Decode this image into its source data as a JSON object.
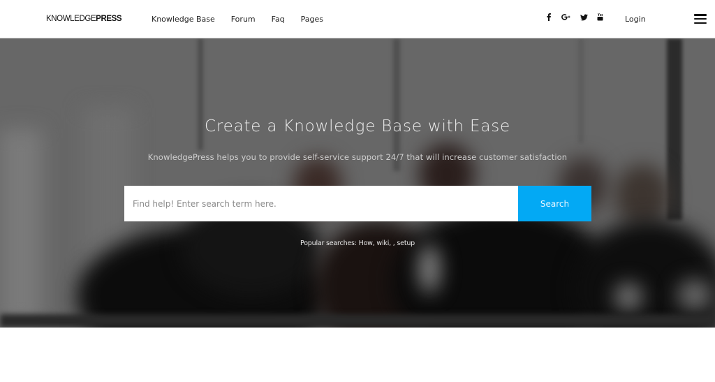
{
  "header": {
    "logo_light": "KNOWLEDGE",
    "logo_bold": "PRESS",
    "nav": [
      {
        "label": "Knowledge Base"
      },
      {
        "label": "Forum"
      },
      {
        "label": "Faq"
      },
      {
        "label": "Pages"
      }
    ],
    "social": [
      {
        "name": "facebook-icon",
        "glyph": "f"
      },
      {
        "name": "google-plus-icon",
        "glyph": "G+"
      },
      {
        "name": "twitter-icon",
        "glyph": "twitter"
      },
      {
        "name": "youtube-icon",
        "glyph": "youtube"
      }
    ],
    "login_label": "Login",
    "menu_icon": "hamburger-icon"
  },
  "hero": {
    "title": "Create a Knowledge Base with Ease",
    "subtitle": "KnowledgePress helps you to provide self-service support 24/7 that will increase customer satisfaction",
    "search": {
      "placeholder": "Find help! Enter search term here.",
      "value": "",
      "button_label": "Search"
    },
    "popular_prefix": "Popular searches:",
    "popular_terms": [
      "How",
      "wiki",
      "",
      "setup"
    ],
    "popular_text": "How, wiki, , setup"
  },
  "colors": {
    "accent": "#03a9f4",
    "hero_overlay": "#676767",
    "header_bg": "#ffffff"
  }
}
